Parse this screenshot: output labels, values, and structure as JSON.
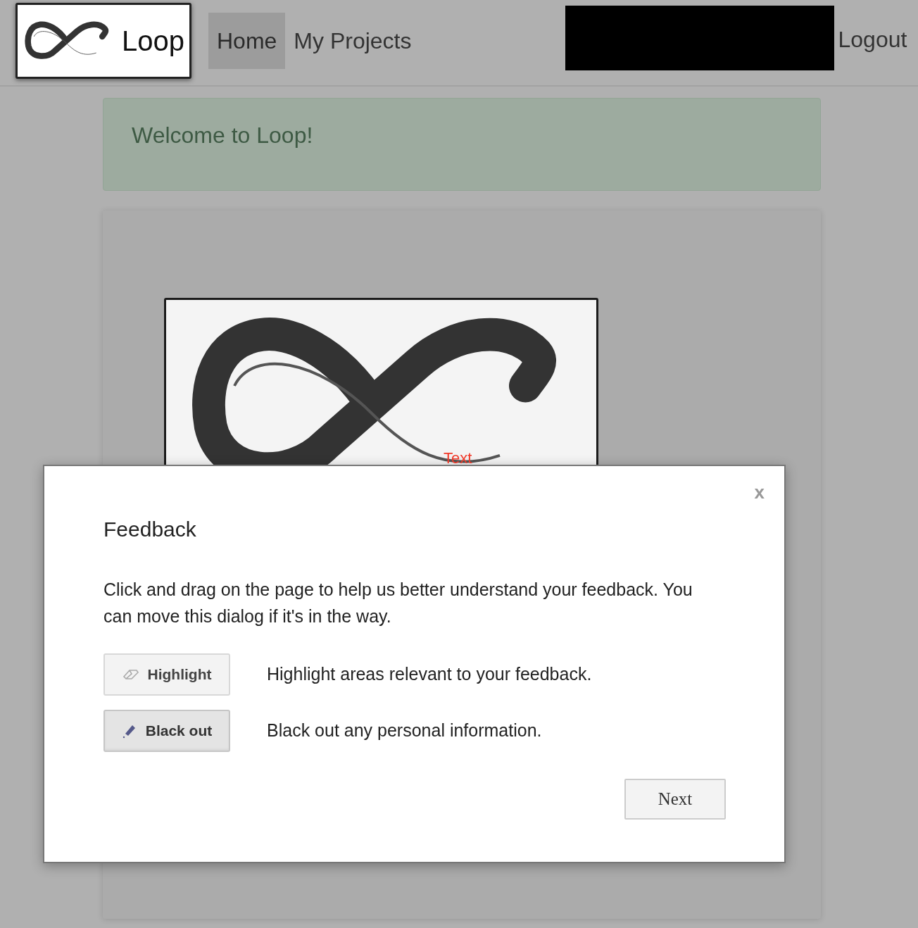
{
  "navbar": {
    "brand": "Loop",
    "items": [
      {
        "label": "Home",
        "selected": true
      },
      {
        "label": "My Projects",
        "selected": false
      }
    ],
    "logout": "Logout"
  },
  "alert": {
    "text": "Welcome to Loop!"
  },
  "annotation": {
    "text": "Text"
  },
  "dialog": {
    "close": "x",
    "title": "Feedback",
    "description": "Click and drag on the page to help us better understand your feedback. You can move this dialog if it's in the way.",
    "tools": [
      {
        "kind": "highlight",
        "label": "Highlight",
        "description": "Highlight areas relevant to your feedback.",
        "selected": false
      },
      {
        "kind": "blackout",
        "label": "Black out",
        "description": "Black out any personal information.",
        "selected": true
      }
    ],
    "next": "Next"
  }
}
